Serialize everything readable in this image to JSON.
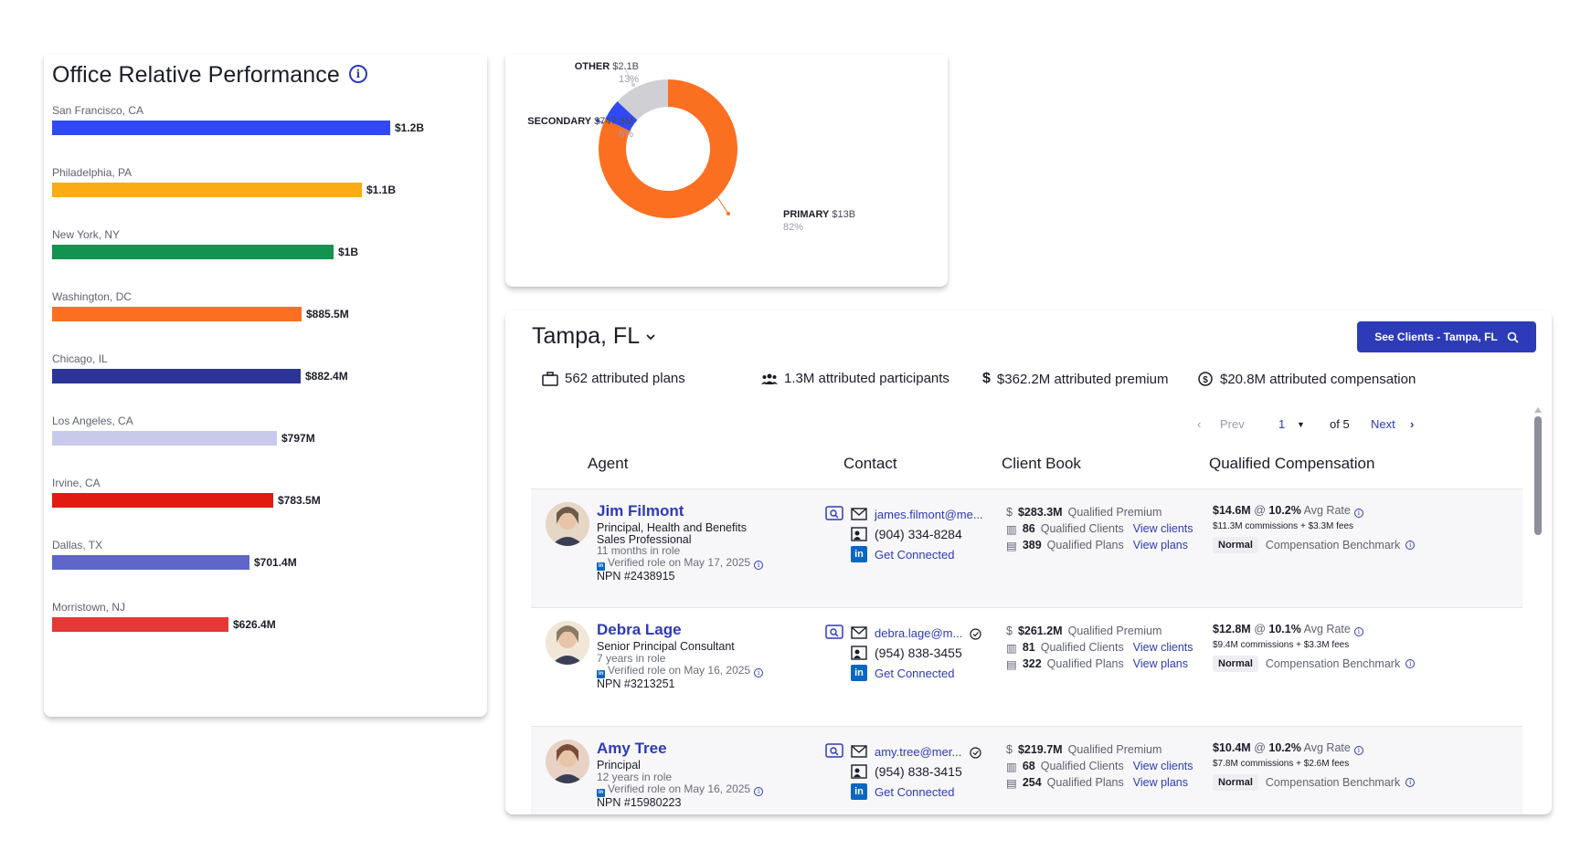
{
  "performance": {
    "title": "Office Relative Performance",
    "bars": [
      {
        "label": "San Francisco, CA",
        "value": "$1.2B",
        "amount": 1200,
        "color": "#3049f2"
      },
      {
        "label": "Philadelphia, PA",
        "value": "$1.1B",
        "amount": 1100,
        "color": "#fbac13"
      },
      {
        "label": "New York, NY",
        "value": "$1B",
        "amount": 1000,
        "color": "#14924f"
      },
      {
        "label": "Washington, DC",
        "value": "$885.5M",
        "amount": 885.5,
        "color": "#fb6f21"
      },
      {
        "label": "Chicago, IL",
        "value": "$882.4M",
        "amount": 882.4,
        "color": "#2c3597"
      },
      {
        "label": "Los Angeles, CA",
        "value": "$797M",
        "amount": 797,
        "color": "#c9c9ec"
      },
      {
        "label": "Irvine, CA",
        "value": "$783.5M",
        "amount": 783.5,
        "color": "#e11b12"
      },
      {
        "label": "Dallas, TX",
        "value": "$701.4M",
        "amount": 701.4,
        "color": "#5e66c9"
      },
      {
        "label": "Morristown, NJ",
        "value": "$626.4M",
        "amount": 626.4,
        "color": "#e63737"
      }
    ]
  },
  "donut": {
    "slices": [
      {
        "name": "PRIMARY",
        "value": "$13B",
        "percent": "82%",
        "share": 82,
        "color": "#fb6f21"
      },
      {
        "name": "SECONDARY",
        "value": "$747.3M",
        "percent": "5%",
        "share": 5,
        "color": "#3049f2"
      },
      {
        "name": "OTHER",
        "value": "$2.1B",
        "percent": "13%",
        "share": 13,
        "color": "#cfcfd4"
      }
    ]
  },
  "location": {
    "title": "Tampa, FL",
    "button_label": "See Clients - Tampa, FL",
    "stats": {
      "plans": "562 attributed plans",
      "participants": "1.3M attributed participants",
      "premium": "$362.2M attributed premium",
      "compensation": "$20.8M attributed compensation"
    },
    "pager": {
      "prev": "Prev",
      "page": "1",
      "of": "of 5",
      "next": "Next"
    },
    "columns": {
      "agent": "Agent",
      "contact": "Contact",
      "book": "Client Book",
      "comp": "Qualified Compensation"
    },
    "agents": [
      {
        "name": "Jim Filmont",
        "role": "Principal, Health and Benefits Sales Professional",
        "tenure": "11 months in role",
        "verified": "Verified role on May 17, 2025",
        "npn": "NPN #2438915",
        "email": "james.filmont@me...",
        "phone": "(904) 334-8284",
        "connect": "Get Connected",
        "premium": "$283.3M",
        "premium_label": "Qualified Premium",
        "clients": "86",
        "clients_label": "Qualified Clients",
        "view_clients": "View clients",
        "plans": "389",
        "plans_label": "Qualified Plans",
        "view_plans": "View plans",
        "comp": "$14.6M",
        "at": "@",
        "rate": "10.2%",
        "rate_label": "Avg Rate",
        "breakdown": "$11.3M commissions + $3.3M fees",
        "benchmark": "Normal",
        "benchmark_label": "Compensation Benchmark"
      },
      {
        "name": "Debra Lage",
        "role": "Senior Principal Consultant",
        "tenure": "7 years in role",
        "verified": "Verified role on May 16, 2025",
        "npn": "NPN #3213251",
        "email": "debra.lage@m...",
        "phone": "(954) 838-3455",
        "connect": "Get Connected",
        "premium": "$261.2M",
        "premium_label": "Qualified Premium",
        "clients": "81",
        "clients_label": "Qualified Clients",
        "view_clients": "View clients",
        "plans": "322",
        "plans_label": "Qualified Plans",
        "view_plans": "View plans",
        "comp": "$12.8M",
        "at": "@",
        "rate": "10.1%",
        "rate_label": "Avg Rate",
        "breakdown": "$9.4M commissions + $3.3M fees",
        "benchmark": "Normal",
        "benchmark_label": "Compensation Benchmark"
      },
      {
        "name": "Amy Tree",
        "role": "Principal",
        "tenure": "12 years in role",
        "verified": "Verified role on May 16, 2025",
        "npn": "NPN #15980223",
        "email": "amy.tree@mer...",
        "phone": "(954) 838-3415",
        "connect": "Get Connected",
        "premium": "$219.7M",
        "premium_label": "Qualified Premium",
        "clients": "68",
        "clients_label": "Qualified Clients",
        "view_clients": "View clients",
        "plans": "254",
        "plans_label": "Qualified Plans",
        "view_plans": "View plans",
        "comp": "$10.4M",
        "at": "@",
        "rate": "10.2%",
        "rate_label": "Avg Rate",
        "breakdown": "$7.8M commissions + $2.6M fees",
        "benchmark": "Normal",
        "benchmark_label": "Compensation Benchmark"
      }
    ]
  }
}
